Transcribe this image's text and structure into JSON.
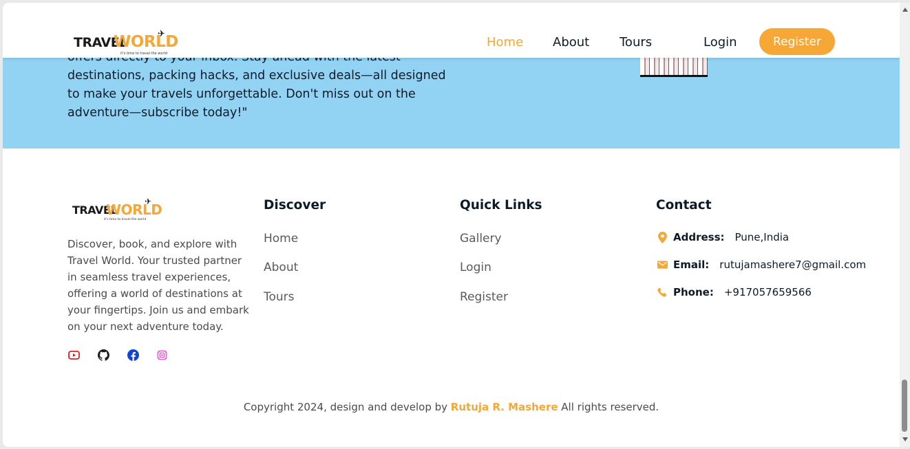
{
  "brand": {
    "word1": "TRAVEL",
    "word2": "WORLD",
    "tagline": "it's time to travel the world"
  },
  "header": {
    "nav": [
      {
        "label": "Home",
        "active": true
      },
      {
        "label": "About",
        "active": false
      },
      {
        "label": "Tours",
        "active": false
      }
    ],
    "login_label": "Login",
    "register_label": "Register"
  },
  "newsletter": {
    "text": "offers directly to your inbox. Stay ahead with the latest destinations, packing hacks, and exclusive deals—all designed to make your travels unforgettable. Don't miss out on the adventure—subscribe today!\""
  },
  "footer": {
    "about": "Discover, book, and explore with Travel World. Your trusted partner in seamless travel experiences, offering a world of destinations at your fingertips. Join us and embark on your next adventure today.",
    "social": [
      "youtube-icon",
      "github-icon",
      "facebook-icon",
      "instagram-icon"
    ],
    "discover": {
      "title": "Discover",
      "links": [
        "Home",
        "About",
        "Tours"
      ]
    },
    "quick_links": {
      "title": "Quick Links",
      "links": [
        "Gallery",
        "Login",
        "Register"
      ]
    },
    "contact": {
      "title": "Contact",
      "address_label": "Address:",
      "address_value": "Pune,India",
      "email_label": "Email:",
      "email_value": "rutujamashere7@gmail.com",
      "phone_label": "Phone:",
      "phone_value": "+917057659566"
    },
    "copyright": {
      "prefix": "Copyright 2024, design and develop by",
      "author": "Rutuja R. Mashere",
      "suffix": "All rights reserved."
    }
  },
  "colors": {
    "accent": "#f6a735",
    "band": "#92d2f3",
    "youtube": "#e02020",
    "facebook": "#1046d6",
    "instagram": "#e66bd8"
  }
}
